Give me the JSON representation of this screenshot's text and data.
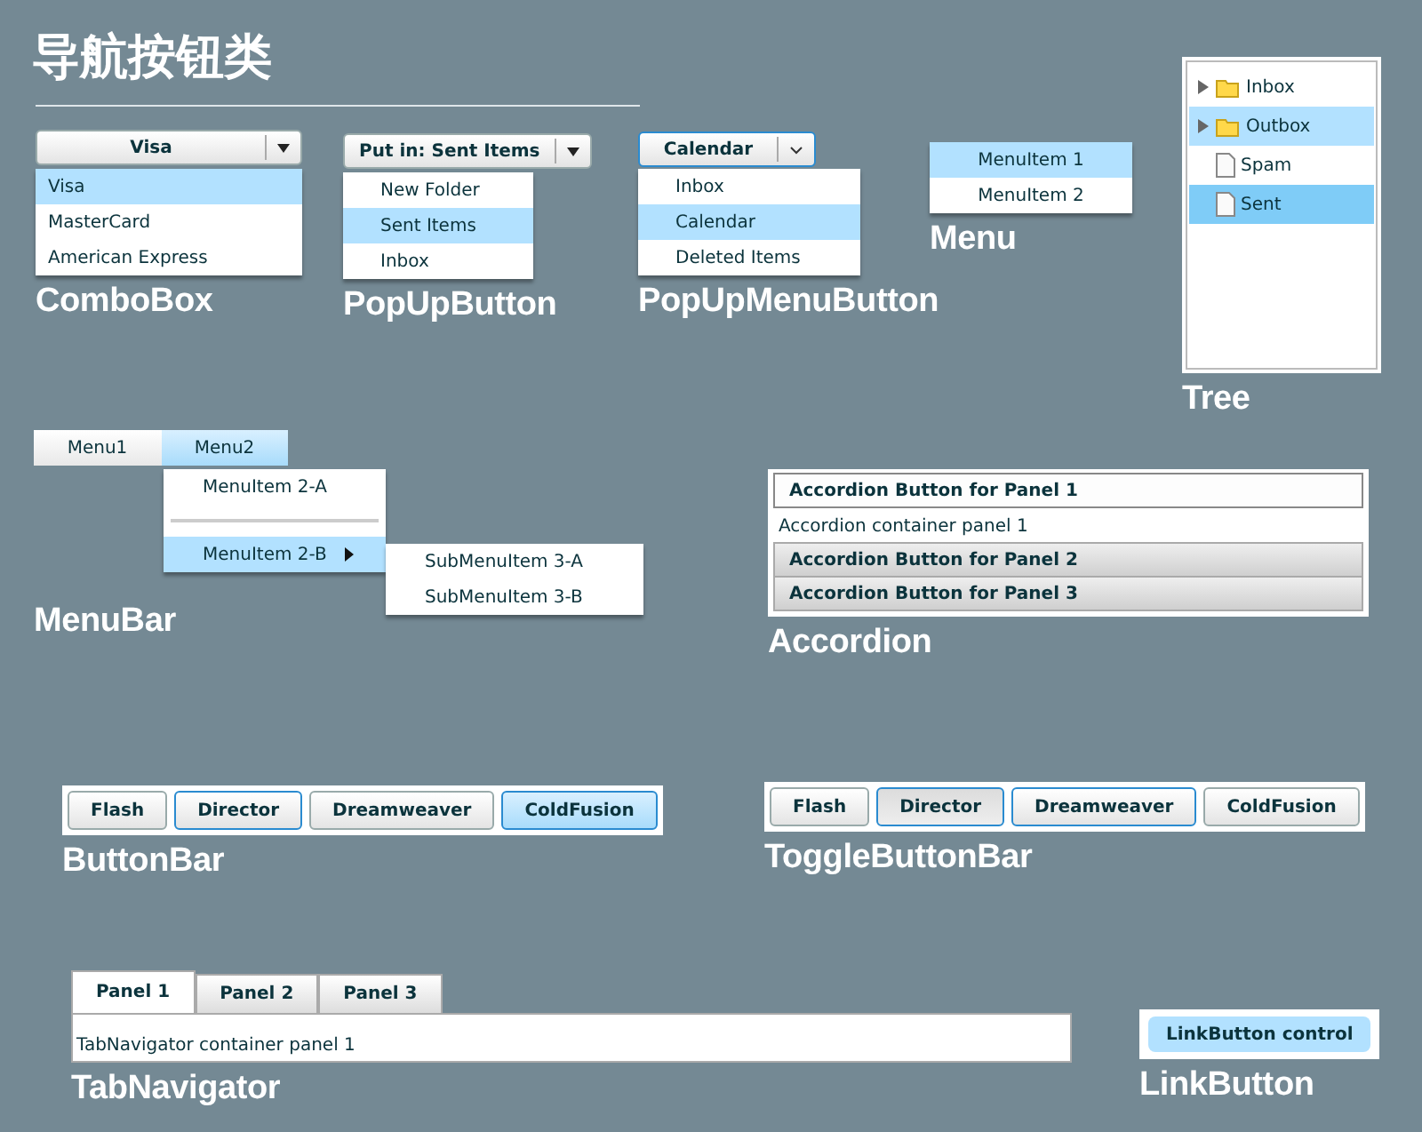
{
  "title": "导航按钮类",
  "combo_box": {
    "value": "Visa",
    "caption": "ComboBox",
    "options": [
      {
        "label": "Visa",
        "selected": true
      },
      {
        "label": "MasterCard",
        "selected": false
      },
      {
        "label": "American Express",
        "selected": false
      }
    ]
  },
  "popup_button": {
    "label": "Put in: Sent Items",
    "caption": "PopUpButton",
    "items": [
      {
        "label": "New Folder",
        "selected": false
      },
      {
        "label": "Sent Items",
        "selected": true
      },
      {
        "label": "Inbox",
        "selected": false
      }
    ]
  },
  "popup_menu_button": {
    "label": "Calendar",
    "caption": "PopUpMenuButton",
    "items": [
      {
        "label": "Inbox",
        "selected": false
      },
      {
        "label": "Calendar",
        "selected": true
      },
      {
        "label": "Deleted Items",
        "selected": false
      }
    ]
  },
  "menu": {
    "caption": "Menu",
    "items": [
      {
        "label": "MenuItem 1",
        "selected": true
      },
      {
        "label": "MenuItem 2",
        "selected": false
      }
    ]
  },
  "tree": {
    "caption": "Tree",
    "items": [
      {
        "label": "Inbox",
        "kind": "folder",
        "expanded": false,
        "selected": false
      },
      {
        "label": "Outbox",
        "kind": "folder",
        "expanded": false,
        "selected": false,
        "hovered": true
      },
      {
        "label": "Spam",
        "kind": "file",
        "selected": false
      },
      {
        "label": "Sent",
        "kind": "file",
        "selected": true
      }
    ]
  },
  "menu_bar": {
    "caption": "MenuBar",
    "menus": [
      {
        "label": "Menu1",
        "selected": false
      },
      {
        "label": "Menu2",
        "selected": true
      }
    ],
    "submenu": [
      {
        "kind": "item",
        "label": "MenuItem 2-A",
        "selected": false
      },
      {
        "kind": "separator"
      },
      {
        "kind": "branch",
        "label": "MenuItem 2-B",
        "selected": true
      }
    ],
    "sub_submenu": [
      {
        "kind": "item",
        "label": "SubMenuItem 3-A",
        "selected": false
      },
      {
        "kind": "item",
        "label": "SubMenuItem 3-B",
        "selected": false
      }
    ]
  },
  "accordion": {
    "caption": "Accordion",
    "panels": [
      {
        "header": "Accordion Button for Panel 1",
        "expanded": true,
        "content": "Accordion container panel 1"
      },
      {
        "header": "Accordion Button for Panel 2",
        "expanded": false
      },
      {
        "header": "Accordion Button for Panel 3",
        "expanded": false
      }
    ]
  },
  "button_bar": {
    "caption": "ButtonBar",
    "buttons": [
      {
        "label": "Flash",
        "selected": false,
        "focused": false
      },
      {
        "label": "Director",
        "selected": false,
        "focused": true
      },
      {
        "label": "Dreamweaver",
        "selected": false,
        "focused": false
      },
      {
        "label": "ColdFusion",
        "selected": true,
        "focused": true
      }
    ]
  },
  "toggle_button_bar": {
    "caption": "ToggleButtonBar",
    "buttons": [
      {
        "label": "Flash",
        "selected": false,
        "focused": false
      },
      {
        "label": "Director",
        "selected": true,
        "focused": true
      },
      {
        "label": "Dreamweaver",
        "selected": false,
        "focused": true
      },
      {
        "label": "ColdFusion",
        "selected": false,
        "focused": false
      }
    ]
  },
  "tab_navigator": {
    "caption": "TabNavigator",
    "content": "TabNavigator container panel 1",
    "tabs": [
      {
        "label": "Panel 1",
        "selected": true
      },
      {
        "label": "Panel 2",
        "selected": false
      },
      {
        "label": "Panel 3",
        "selected": false
      }
    ]
  },
  "link_button": {
    "caption": "LinkButton",
    "label": "LinkButton control"
  }
}
